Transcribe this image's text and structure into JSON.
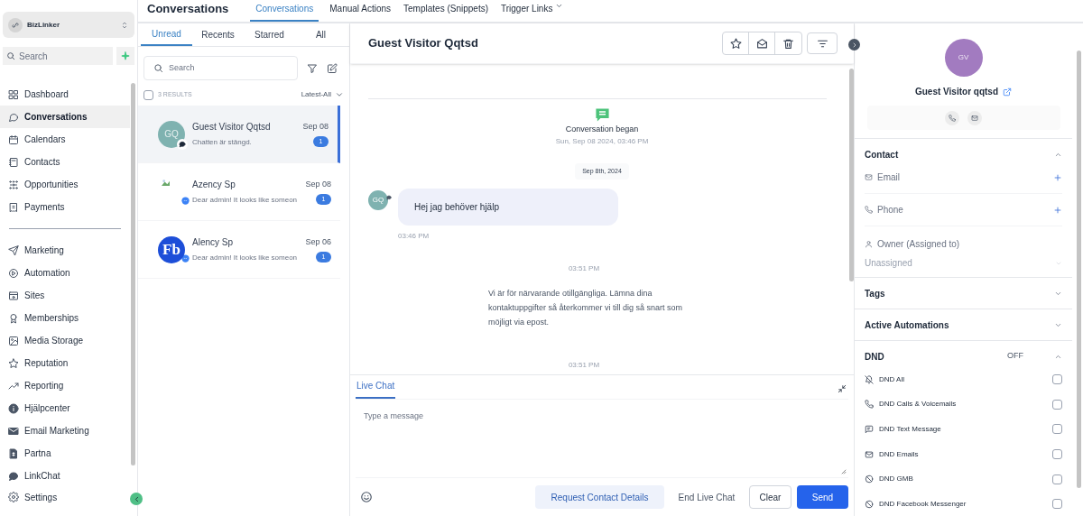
{
  "workspace": {
    "name": "BizLinker"
  },
  "sidebar": {
    "search_placeholder": "Search",
    "groups": [
      [
        {
          "label": "Dashboard",
          "selected": false
        },
        {
          "label": "Conversations",
          "selected": true
        },
        {
          "label": "Calendars",
          "selected": false
        },
        {
          "label": "Contacts",
          "selected": false
        },
        {
          "label": "Opportunities",
          "selected": false
        },
        {
          "label": "Payments",
          "selected": false
        }
      ],
      [
        {
          "label": "Marketing",
          "selected": false
        },
        {
          "label": "Automation",
          "selected": false
        },
        {
          "label": "Sites",
          "selected": false
        },
        {
          "label": "Memberships",
          "selected": false
        },
        {
          "label": "Media Storage",
          "selected": false
        },
        {
          "label": "Reputation",
          "selected": false
        },
        {
          "label": "Reporting",
          "selected": false
        },
        {
          "label": "Hjälpcenter",
          "selected": false
        },
        {
          "label": "Email Marketing",
          "selected": false
        },
        {
          "label": "Partna",
          "selected": false
        },
        {
          "label": "LinkChat",
          "selected": false
        }
      ]
    ],
    "settings": "Settings"
  },
  "header": {
    "title": "Conversations",
    "tabs": [
      {
        "label": "Conversations",
        "selected": true,
        "dropdown": false
      },
      {
        "label": "Manual Actions",
        "selected": false,
        "dropdown": false
      },
      {
        "label": "Templates (Snippets)",
        "selected": false,
        "dropdown": false
      },
      {
        "label": "Trigger Links",
        "selected": false,
        "dropdown": true
      }
    ]
  },
  "conversation_list": {
    "tabs": [
      {
        "label": "Unread",
        "selected": true
      },
      {
        "label": "Recents",
        "selected": false
      },
      {
        "label": "Starred",
        "selected": false
      },
      {
        "label": "All",
        "selected": false
      }
    ],
    "search_placeholder": "Search",
    "select_all": {
      "checked": false
    },
    "results": "3 RESULTS",
    "sort": "Latest-All",
    "items": [
      {
        "name": "Guest Visitor Qqtsd",
        "preview": "Chatten är stängd.",
        "date": "Sep 08",
        "unread": "1",
        "selected": true,
        "avatar": {
          "kind": "initials",
          "text": "GQ",
          "color": "#7fb2b0"
        },
        "kind": "live_chat"
      },
      {
        "name": "Azency Sp",
        "preview": "Dear admin! It looks like someon",
        "date": "Sep 08",
        "unread": "1",
        "selected": false,
        "avatar": {
          "kind": "broken"
        },
        "kind": "messenger"
      },
      {
        "name": "Alency Sp",
        "preview": "Dear admin! It looks like someon",
        "date": "Sep 06",
        "unread": "1",
        "selected": false,
        "avatar": {
          "kind": "logo",
          "text": "Fb",
          "color": "#1d4ed8"
        },
        "kind": "messenger"
      }
    ]
  },
  "chat": {
    "title": "Guest Visitor Qqtsd",
    "began": {
      "title": "Conversation began",
      "time": "Sun, Sep 08 2024, 03:46 PM"
    },
    "date_chip": "Sep 8th, 2024",
    "messages": [
      {
        "kind": "inbound",
        "avatar": "GQ",
        "text": "Hej jag behöver hjälp",
        "time": "03:46 PM"
      },
      {
        "kind": "automatic",
        "time": "03:51 PM",
        "text": "Vi är för närvarande otillgängliga. Lämna dina kontaktuppgifter så återkommer vi till dig så snart som möjligt via epost."
      },
      {
        "kind": "timestamp",
        "time": "03:51 PM"
      }
    ]
  },
  "composer": {
    "tabs": [
      {
        "label": "Live Chat",
        "selected": true
      }
    ],
    "placeholder": "Type a message",
    "buttons": [
      {
        "label": "Request Contact Details",
        "kind": "soft"
      },
      {
        "label": "End Live Chat",
        "kind": "ghost"
      },
      {
        "label": "Clear",
        "kind": "outline"
      },
      {
        "label": "Send",
        "kind": "primary"
      }
    ]
  },
  "contact": {
    "avatar": {
      "initials": "GV",
      "color": "#a27bc0"
    },
    "name": "Guest Visitor qqtsd",
    "sections": [
      {
        "title": "Contact",
        "expanded": true,
        "fields": [
          {
            "label": "Email",
            "kind": "add"
          },
          {
            "label": "Phone",
            "kind": "add"
          },
          {
            "label": "Owner (Assigned to)",
            "kind": "select",
            "value": "Unassigned"
          }
        ]
      },
      {
        "title": "Tags",
        "expanded": false
      },
      {
        "title": "Active Automations",
        "expanded": false
      },
      {
        "title": "DND",
        "expanded": true,
        "status": "OFF",
        "options": [
          {
            "label": "DND All",
            "checked": false
          },
          {
            "label": "DND Calls & Voicemails",
            "checked": false
          },
          {
            "label": "DND Text Message",
            "checked": false
          },
          {
            "label": "DND Emails",
            "checked": false
          },
          {
            "label": "DND GMB",
            "checked": false
          },
          {
            "label": "DND Facebook Messenger",
            "checked": false
          }
        ]
      }
    ]
  }
}
